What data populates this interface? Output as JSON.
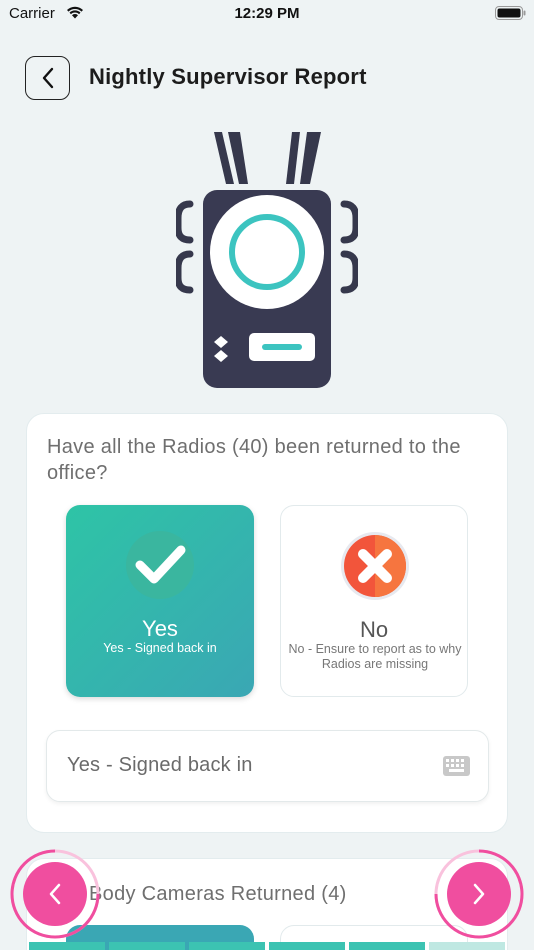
{
  "status_bar": {
    "carrier": "Carrier",
    "time": "12:29 PM",
    "wifi_icon": "wifi-icon",
    "battery_icon": "battery-icon"
  },
  "header": {
    "back_icon": "chevron-left-icon",
    "title": "Nightly Supervisor Report"
  },
  "illustration": {
    "icon": "two-way-radio-icon"
  },
  "question": {
    "text": "Have all the Radios (40) been returned to the office?",
    "options": [
      {
        "title": "Yes",
        "subtitle": "Yes - Signed back in",
        "icon": "check-icon",
        "selected": true
      },
      {
        "title": "No",
        "subtitle": "No - Ensure to report as to why Radios are missing",
        "icon": "cross-icon",
        "selected": false
      }
    ],
    "answer_value": "Yes - Signed back in",
    "answer_icon": "keyboard-icon"
  },
  "next_question": {
    "text": "Body Cameras Returned (4)"
  },
  "navigation": {
    "prev_icon": "chevron-left-icon",
    "next_icon": "chevron-right-icon"
  },
  "progress": {
    "segments_total": 6,
    "segments_completed": 5
  },
  "colors": {
    "accent_teal": "#3aa7b4",
    "selected_gradient_start": "#2ec4a6",
    "nav_pink": "#f04e9f",
    "no_icon_orange": "#f2553b",
    "background": "#eef3f4"
  }
}
